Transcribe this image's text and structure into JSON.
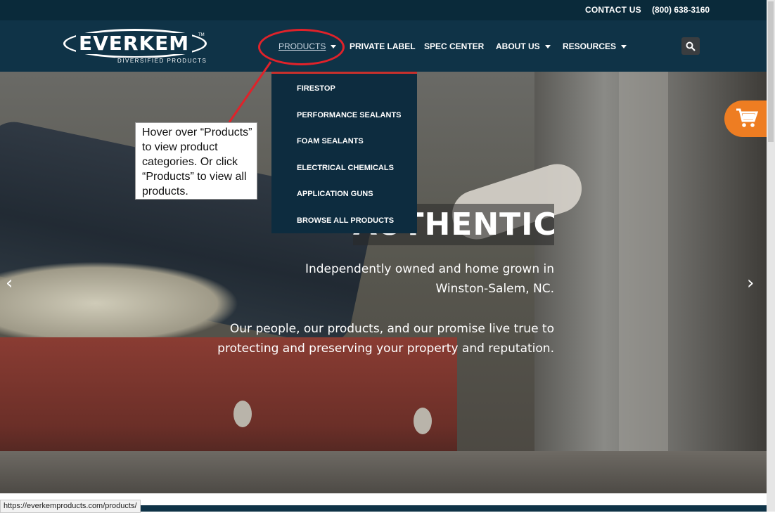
{
  "topbar": {
    "contact_label": "CONTACT US",
    "phone": "(800) 638-3160"
  },
  "logo": {
    "brand": "EVERKEM",
    "tm": "TM",
    "subtitle": "DIVERSIFIED PRODUCTS"
  },
  "nav": {
    "products": "PRODUCTS",
    "private_label": "PRIVATE LABEL",
    "spec_center": "SPEC CENTER",
    "about_us": "ABOUT US",
    "resources": "RESOURCES",
    "search_icon": "search-icon"
  },
  "dropdown": {
    "items": [
      "FIRESTOP",
      "PERFORMANCE SEALANTS",
      "FOAM SEALANTS",
      "ELECTRICAL CHEMICALS",
      "APPLICATION GUNS",
      "BROWSE ALL PRODUCTS"
    ]
  },
  "hero": {
    "headline": "AUTHENTIC",
    "tagline1": "Independently owned and home grown in Winston-Salem, NC.",
    "tagline2": "Our people, our products, and our promise live true to protecting and preserving your property and reputation."
  },
  "callout": {
    "text": "Hover over “Products” to view product categories. Or click “Products” to view all products."
  },
  "status_bar": {
    "url": "https://everkemproducts.com/products/"
  },
  "colors": {
    "nav_bg": "#0f3347",
    "topbar_bg": "#0a2a3a",
    "accent_red": "#c9302c",
    "callout_red": "#e0222a",
    "cart_orange": "#ee7d22"
  }
}
